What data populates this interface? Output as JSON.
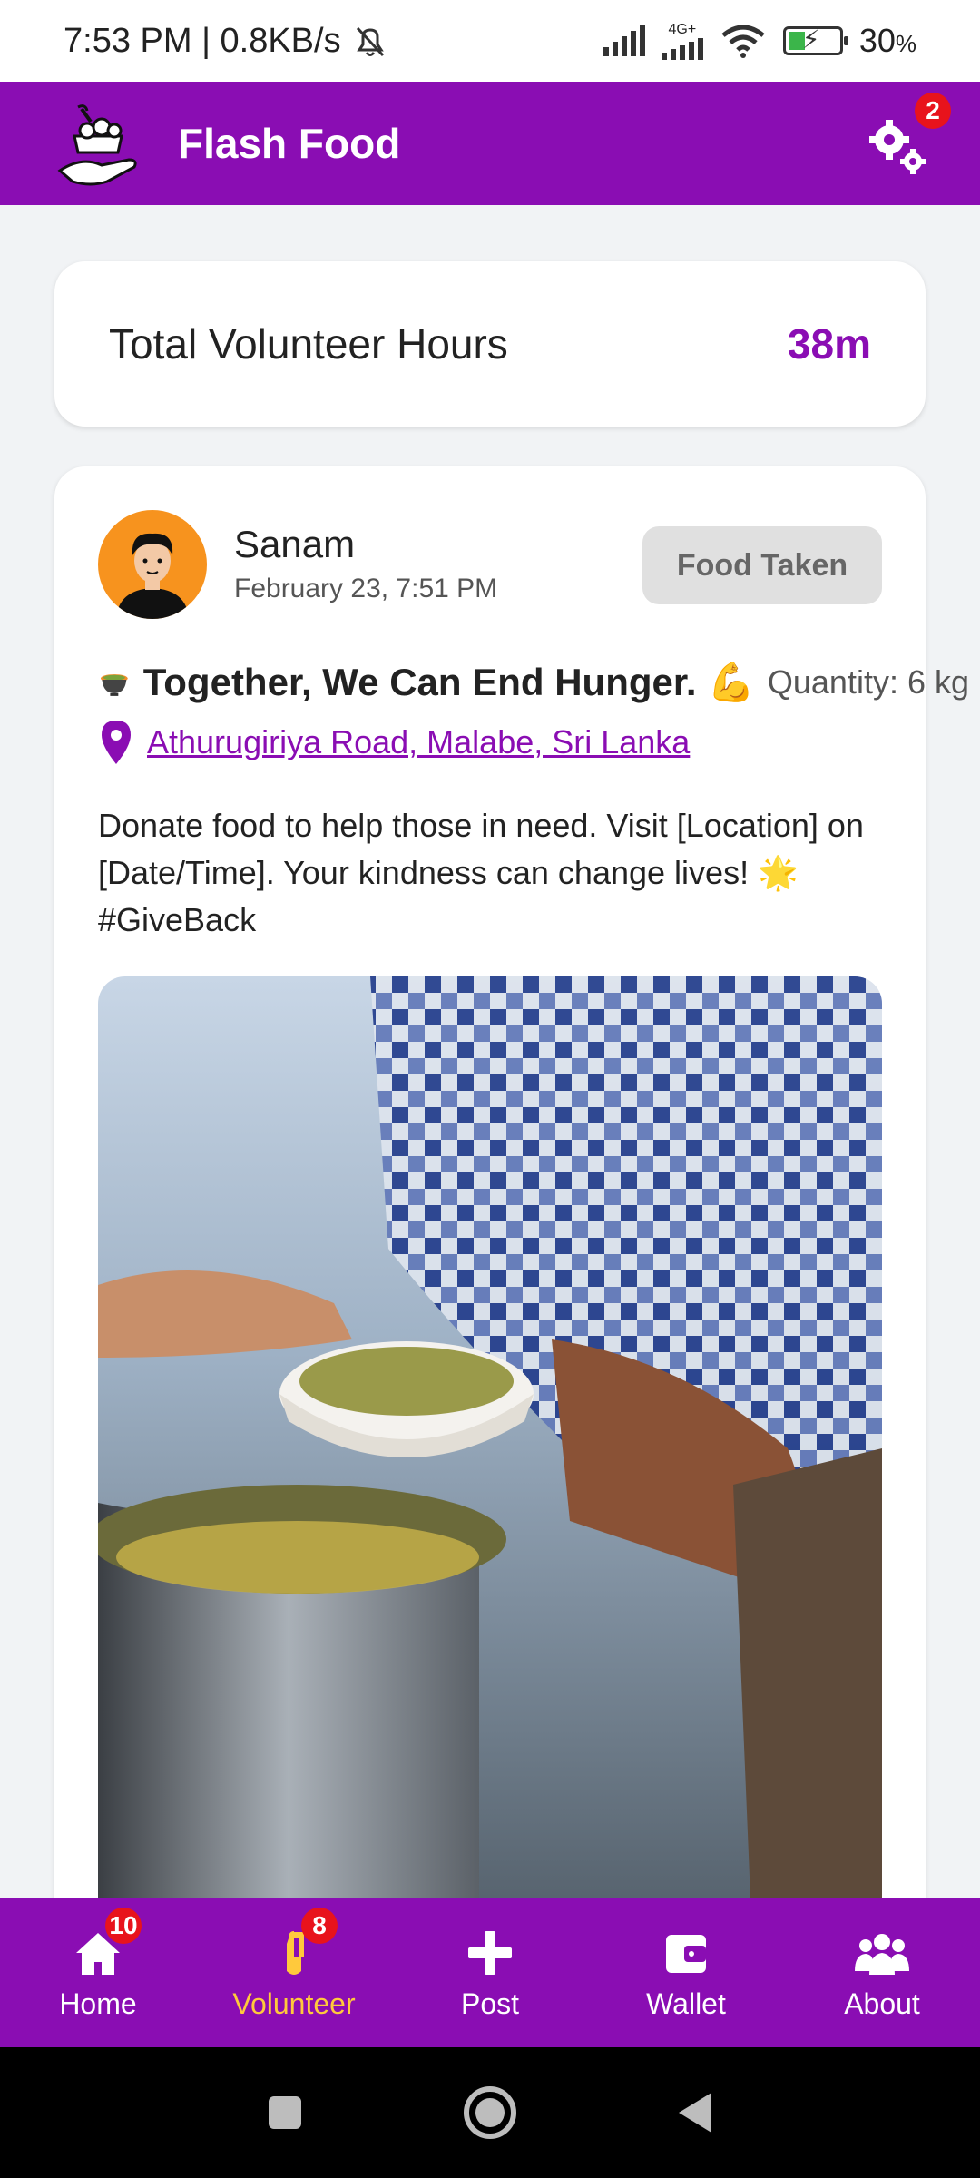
{
  "status_bar": {
    "time_speed": "7:53 PM | 0.8KB/s",
    "network_label": "4G+",
    "battery": "30",
    "battery_unit": "%"
  },
  "header": {
    "app_title": "Flash Food",
    "settings_badge": "2"
  },
  "hours_card": {
    "label": "Total Volunteer Hours",
    "value": "38m"
  },
  "post": {
    "user_name": "Sanam",
    "date": "February 23, 7:51 PM",
    "status_button": "Food Taken",
    "headline": "Together, We Can End Hunger.",
    "quantity": "Quantity: 6 kg",
    "location": "Athurugiriya Road, Malabe, Sri Lanka",
    "description": "Donate food to help those in need. Visit [Location] on [Date/Time]. Your kindness can change lives! 🌟 #GiveBack"
  },
  "bottom_nav": {
    "items": [
      {
        "label": "Home",
        "icon": "home-icon",
        "badge": "10"
      },
      {
        "label": "Volunteer",
        "icon": "volunteer-icon",
        "badge": "8"
      },
      {
        "label": "Post",
        "icon": "plus-icon"
      },
      {
        "label": "Wallet",
        "icon": "wallet-icon"
      },
      {
        "label": "About",
        "icon": "people-icon"
      }
    ]
  },
  "colors": {
    "brand": "#8a0db3",
    "active_nav": "#ffc93c",
    "badge": "#e8131c"
  }
}
